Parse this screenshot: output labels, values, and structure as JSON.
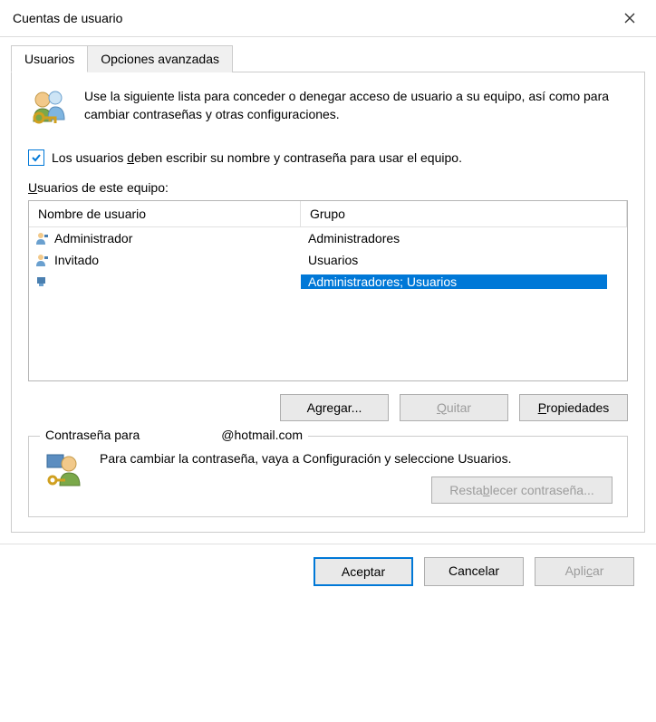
{
  "window": {
    "title": "Cuentas de usuario"
  },
  "tabs": [
    {
      "label": "Usuarios",
      "active": true
    },
    {
      "label": "Opciones avanzadas",
      "active": false
    }
  ],
  "intro": "Use la siguiente lista para conceder o denegar acceso de usuario a su equipo, así como para cambiar contraseñas y otras configuraciones.",
  "checkbox": {
    "checked": true,
    "label_pre": "Los usuarios ",
    "label_u": "d",
    "label_post": "eben escribir su nombre y contraseña para usar el equipo."
  },
  "list_label_u": "U",
  "list_label_post": "suarios de este equipo:",
  "columns": {
    "name": "Nombre de usuario",
    "group": "Grupo"
  },
  "rows": [
    {
      "name": "Administrador",
      "group": "Administradores",
      "selected": false
    },
    {
      "name": "Invitado",
      "group": "Usuarios",
      "selected": false
    },
    {
      "name": "",
      "group": "Administradores; Usuarios",
      "selected": true
    }
  ],
  "buttons": {
    "add_pre": "A",
    "add_u": "g",
    "add_post": "regar...",
    "remove_pre": "",
    "remove_u": "Q",
    "remove_post": "uitar",
    "props_pre": "",
    "props_u": "P",
    "props_post": "ropiedades"
  },
  "password_box": {
    "legend_left": "Contraseña para",
    "legend_right": "@hotmail.com",
    "text": "Para cambiar la contraseña, vaya a Configuración y seleccione Usuarios.",
    "reset_pre": "Resta",
    "reset_u": "b",
    "reset_post": "lecer contraseña..."
  },
  "footer": {
    "ok": "Aceptar",
    "cancel": "Cancelar",
    "apply_pre": "Apli",
    "apply_u": "c",
    "apply_post": "ar"
  }
}
